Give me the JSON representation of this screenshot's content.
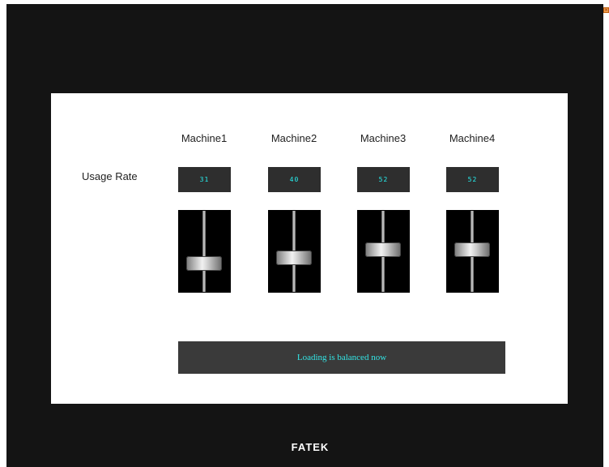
{
  "brand": "FATEK",
  "close_icon": "close-icon",
  "usage_label": "Usage Rate",
  "machines": [
    {
      "label": "Machine1",
      "readout": "31",
      "level": 31
    },
    {
      "label": "Machine2",
      "readout": "40",
      "level": 40
    },
    {
      "label": "Machine3",
      "readout": "52",
      "level": 52
    },
    {
      "label": "Machine4",
      "readout": "52",
      "level": 52
    }
  ],
  "status": "Loading is balanced now",
  "colors": {
    "readout_text": "#26f0f0",
    "status_text": "#33e6e6",
    "device_bezel": "#141414"
  }
}
